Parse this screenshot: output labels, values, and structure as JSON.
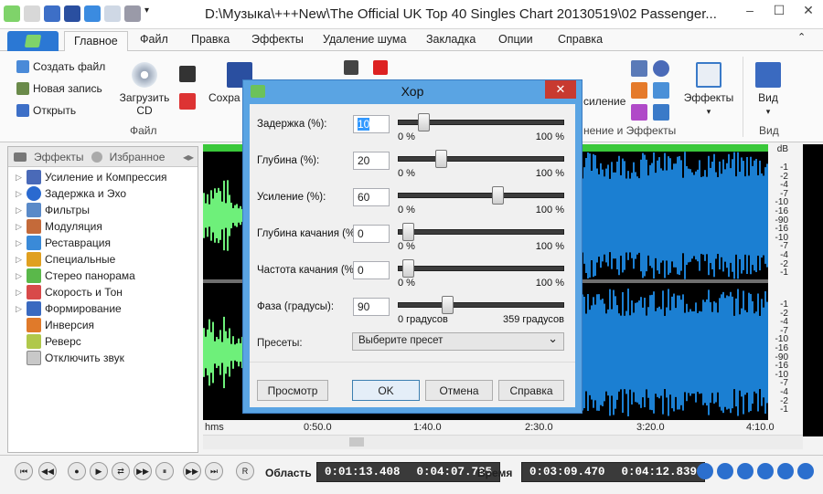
{
  "window": {
    "title": "D:\\Музыка\\+++New\\The Official UK Top 40 Singles Chart 20130519\\02 Passenger..."
  },
  "tabs": [
    "Главное",
    "Файл",
    "Правка",
    "Эффекты",
    "Удаление шума",
    "Закладка",
    "Опции",
    "Справка"
  ],
  "ribbon": {
    "create_file": "Создать файл",
    "new_record": "Новая запись",
    "open": "Открыть",
    "load_cd": "Загрузить CD",
    "save": "Сохра",
    "group_file": "Файл",
    "amplify": "силение",
    "group_effects": "нение и Эффекты",
    "effects": "Эффекты",
    "view": "Вид",
    "group_view": "Вид"
  },
  "panel": {
    "tab_effects": "Эффекты",
    "tab_favorites": "Избранное",
    "items": [
      "Усиление и Компрессия",
      "Задержка и Эхо",
      "Фильтры",
      "Модуляция",
      "Реставрация",
      "Специальные",
      "Стерео панорама",
      "Скорость и Тон",
      "Формирование",
      "Инверсия",
      "Реверс",
      "Отключить звук"
    ]
  },
  "db_scale": {
    "header": "dB",
    "ticks": [
      "-1",
      "-2",
      "-4",
      "-7",
      "-10",
      "-16",
      "-90",
      "-16",
      "-10",
      "-7",
      "-4",
      "-2",
      "-1"
    ]
  },
  "timeline": {
    "labels": [
      "hms",
      "0:50.0",
      "1:40.0",
      "2:30.0",
      "3:20.0",
      "4:10.0"
    ]
  },
  "status": {
    "region_label": "Область",
    "region_start": "0:01:13.408",
    "region_end": "0:04:07.785",
    "time_label": "Время",
    "time_cur": "0:03:09.470",
    "time_total": "0:04:12.839",
    "buttons": [
      "⏮",
      "◀◀",
      "●",
      "▶",
      "⇄",
      "▶▶",
      "⏸",
      "▶▶",
      "⏭",
      "R"
    ]
  },
  "dialog": {
    "title": "Хор",
    "close": "✕",
    "rows": [
      {
        "label": "Задержка (%):",
        "value": "10",
        "min_label": "0 %",
        "max_label": "100 %",
        "level": 0.13
      },
      {
        "label": "Глубина (%):",
        "value": "20",
        "min_label": "0 %",
        "max_label": "100 %",
        "level": 0.24
      },
      {
        "label": "Усиление (%):",
        "value": "60",
        "min_label": "0 %",
        "max_label": "100 %",
        "level": 0.6
      },
      {
        "label": "Глубина качания (%):",
        "value": "0",
        "min_label": "0 %",
        "max_label": "100 %",
        "level": 0.03
      },
      {
        "label": "Частота качания (%):",
        "value": "0",
        "min_label": "0 %",
        "max_label": "100 %",
        "level": 0.03
      },
      {
        "label": "Фаза (градусы):",
        "value": "90",
        "min_label": "0 градусов",
        "max_label": "359 градусов",
        "level": 0.28
      }
    ],
    "presets_label": "Пресеты:",
    "presets_value": "Выберите пресет",
    "btn_preview": "Просмотр",
    "btn_ok": "OK",
    "btn_cancel": "Отмена",
    "btn_help": "Справка"
  },
  "colors": {
    "wave_green": "#6ef07a",
    "wave_blue": "#1b7fd2",
    "accent": "#2b78d4"
  }
}
